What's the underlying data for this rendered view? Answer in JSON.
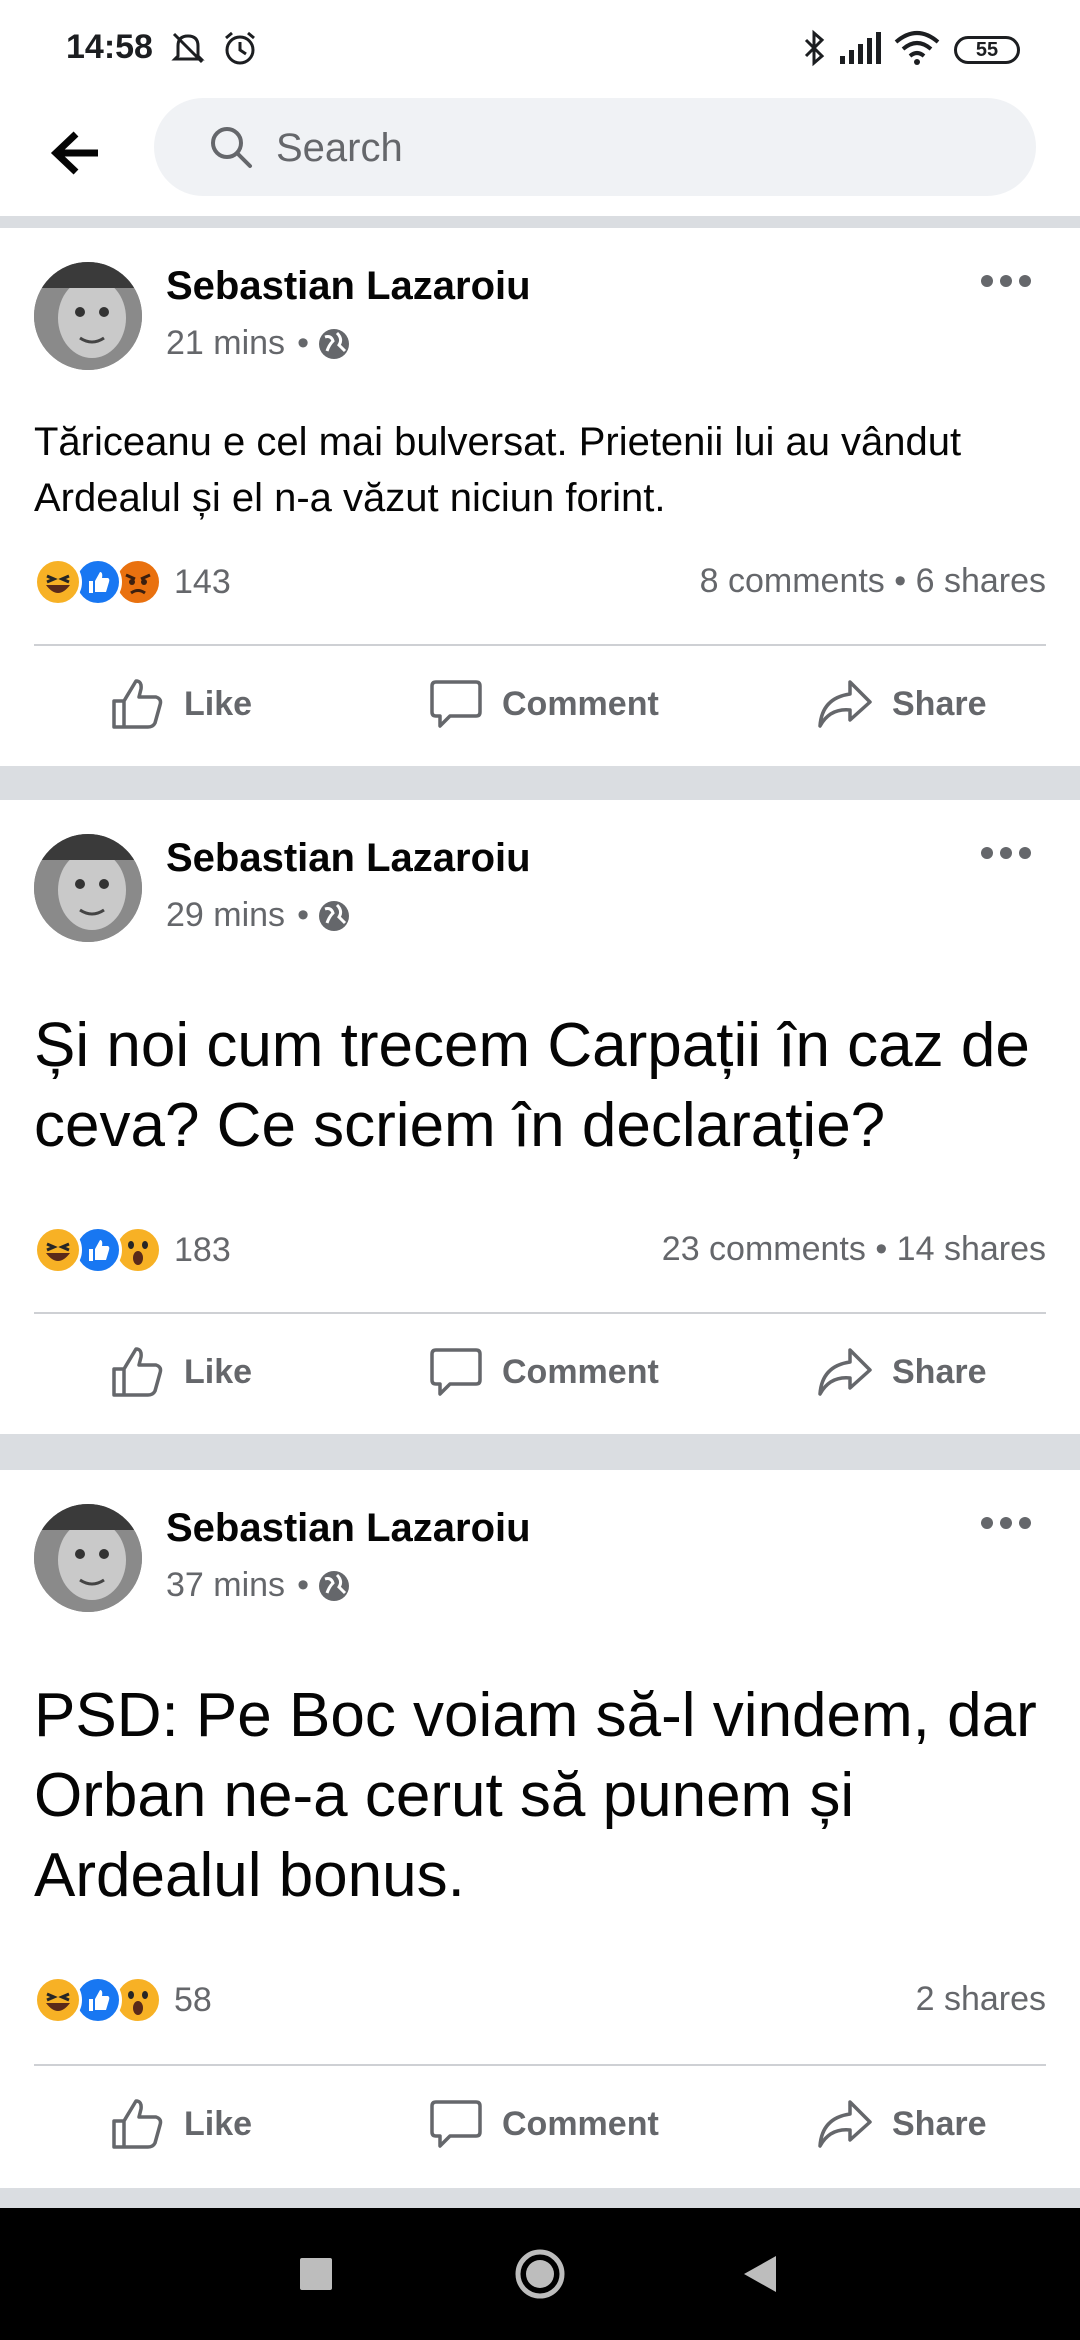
{
  "status_bar": {
    "time": "14:58",
    "battery": "55"
  },
  "search": {
    "placeholder": "Search"
  },
  "posts": [
    {
      "author": "Sebastian Lazaroiu",
      "time": "21 mins",
      "text": "Tăriceanu e cel mai bulversat. Prietenii lui au vândut Ardealul și el n-a văzut niciun forint.",
      "reactions": [
        "haha",
        "like",
        "angry"
      ],
      "reaction_count": "143",
      "counts": "8 comments • 6 shares"
    },
    {
      "author": "Sebastian Lazaroiu",
      "time": "29 mins",
      "text": "Și noi cum trecem Carpații în caz de ceva? Ce scriem în declarație?",
      "reactions": [
        "haha",
        "like",
        "wow"
      ],
      "reaction_count": "183",
      "counts": "23 comments • 14 shares"
    },
    {
      "author": "Sebastian Lazaroiu",
      "time": "37 mins",
      "text": "PSD: Pe Boc voiam să-l vindem, dar Orban ne-a cerut să punem și Ardealul bonus.",
      "reactions": [
        "haha",
        "like",
        "wow"
      ],
      "reaction_count": "58",
      "counts": "2 shares"
    }
  ],
  "actions": {
    "like": "Like",
    "comment": "Comment",
    "share": "Share"
  },
  "colors": {
    "like_blue": "#1877f2",
    "haha_yellow": "#f7b125",
    "angry_orange": "#e9710f",
    "secondary_text": "#65676b"
  }
}
